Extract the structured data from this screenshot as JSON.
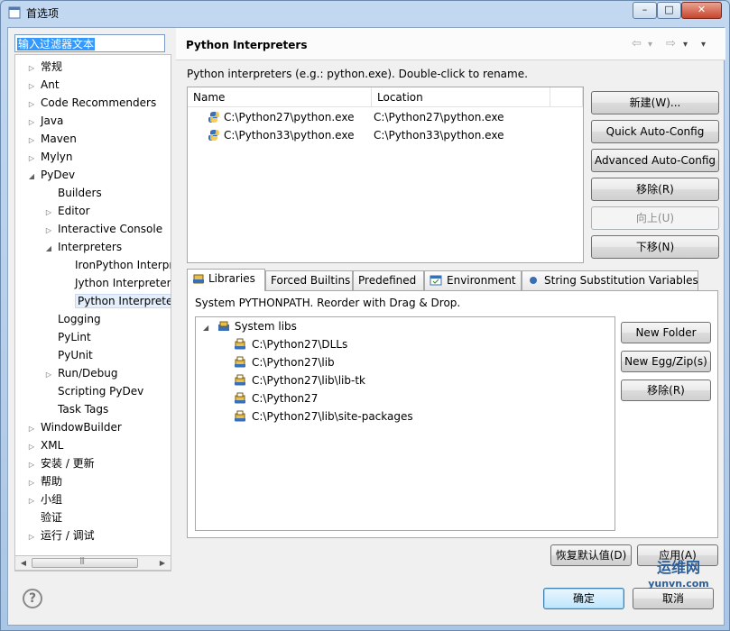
{
  "window": {
    "title": "首选项",
    "minimize_glyph": "–",
    "maximize_glyph": "□",
    "close_glyph": "✕"
  },
  "filter": {
    "value": "输入过滤器文本"
  },
  "tree": {
    "items": [
      {
        "label": "常规",
        "arrow": "▷"
      },
      {
        "label": "Ant",
        "arrow": "▷"
      },
      {
        "label": "Code Recommenders",
        "arrow": "▷"
      },
      {
        "label": "Java",
        "arrow": "▷"
      },
      {
        "label": "Maven",
        "arrow": "▷"
      },
      {
        "label": "Mylyn",
        "arrow": "▷"
      },
      {
        "label": "PyDev",
        "arrow": "◢"
      },
      {
        "label": "Builders",
        "arrow": ""
      },
      {
        "label": "Editor",
        "arrow": "▷"
      },
      {
        "label": "Interactive Console",
        "arrow": "▷"
      },
      {
        "label": "Interpreters",
        "arrow": "◢"
      },
      {
        "label": "IronPython Interpreter",
        "arrow": ""
      },
      {
        "label": "Jython Interpreter",
        "arrow": ""
      },
      {
        "label": "Python Interpreter",
        "arrow": ""
      },
      {
        "label": "Logging",
        "arrow": ""
      },
      {
        "label": "PyLint",
        "arrow": ""
      },
      {
        "label": "PyUnit",
        "arrow": ""
      },
      {
        "label": "Run/Debug",
        "arrow": "▷"
      },
      {
        "label": "Scripting PyDev",
        "arrow": ""
      },
      {
        "label": "Task Tags",
        "arrow": ""
      },
      {
        "label": "WindowBuilder",
        "arrow": "▷"
      },
      {
        "label": "XML",
        "arrow": "▷"
      },
      {
        "label": "安装 / 更新",
        "arrow": "▷"
      },
      {
        "label": "帮助",
        "arrow": "▷"
      },
      {
        "label": "小组",
        "arrow": "▷"
      },
      {
        "label": "验证",
        "arrow": ""
      },
      {
        "label": "运行 / 调试",
        "arrow": "▷"
      }
    ],
    "scroll_left": "◀",
    "scroll_right": "▶"
  },
  "page": {
    "title": "Python Interpreters",
    "nav_back": "⇦",
    "nav_forward": "⇨",
    "nav_menu": "▾",
    "description": "Python interpreters (e.g.: python.exe).   Double-click to rename."
  },
  "interpreters": {
    "columns": [
      "Name",
      "Location"
    ],
    "rows": [
      {
        "name": "C:\\Python27\\python.exe",
        "location": "C:\\Python27\\python.exe"
      },
      {
        "name": "C:\\Python33\\python.exe",
        "location": "C:\\Python33\\python.exe"
      }
    ]
  },
  "side_buttons": {
    "new": "新建(W)...",
    "quick": "Quick Auto-Config",
    "advanced": "Advanced Auto-Config",
    "remove": "移除(R)",
    "up": "向上(U)",
    "down": "下移(N)"
  },
  "tabs": [
    {
      "label": "Libraries"
    },
    {
      "label": "Forced Builtins"
    },
    {
      "label": "Predefined"
    },
    {
      "label": "Environment"
    },
    {
      "label": "String Substitution Variables"
    }
  ],
  "libraries": {
    "description": "System PYTHONPATH.   Reorder with Drag & Drop.",
    "root": "System libs",
    "root_arrow": "◢",
    "paths": [
      "C:\\Python27\\DLLs",
      "C:\\Python27\\lib",
      "C:\\Python27\\lib\\lib-tk",
      "C:\\Python27",
      "C:\\Python27\\lib\\site-packages"
    ],
    "buttons": {
      "new_folder": "New Folder",
      "new_egg": "New Egg/Zip(s)",
      "remove": "移除(R)"
    }
  },
  "footer": {
    "restore": "恢复默认值(D)",
    "apply": "应用(A)",
    "ok": "确定",
    "cancel": "取消",
    "help": "?"
  },
  "watermark": {
    "line1": "运维网",
    "line2": "yunvn.com"
  }
}
